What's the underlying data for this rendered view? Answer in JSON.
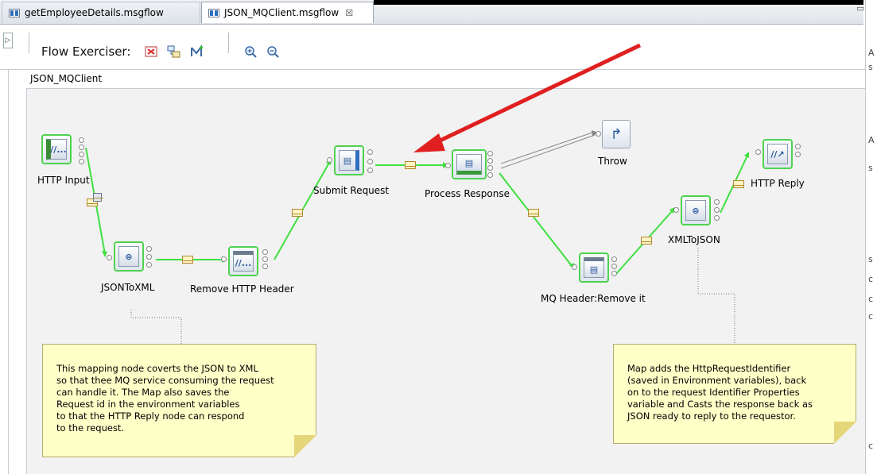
{
  "tabs": [
    {
      "label": "getEmployeeDetails.msgflow"
    },
    {
      "label": "JSON_MQClient.msgflow"
    }
  ],
  "tab_close_glyph": "☒",
  "window_controls": "▭",
  "toolbar": {
    "flow_exerciser_label": "Flow Exerciser:",
    "icons": [
      "stop-recording-icon",
      "view-data-icon",
      "send-message-icon",
      "zoom-in-icon",
      "zoom-out-icon"
    ]
  },
  "breadcrumb": "JSON_MQClient",
  "nodes": {
    "http_input": "HTTP Input",
    "json_to_xml": "JSONToXML",
    "remove_http_header": "Remove HTTP Header",
    "submit_request": "Submit Request",
    "process_response": "Process Response",
    "throw": "Throw",
    "mq_header_remove": "MQ Header:Remove it",
    "xml_to_json": "XMLToJSON",
    "http_reply": "HTTP Reply"
  },
  "notes": {
    "left": "This mapping node coverts the JSON to XML\nso that thee MQ service consuming the request\ncan handle it. The Map also saves the\nRequest id in the environment variables\nto that the HTTP Reply node can respond\nto the request.",
    "right": "Map adds the HttpRequestIdentifier\n(saved in Environment variables), back\non to the request Identifier Properties\nvariable and Casts the response back as\nJSON ready to reply to the requestor."
  },
  "colors": {
    "wire": "#3fe03f",
    "node_border": "#4fd24f",
    "annotation_arrow": "#e02020",
    "note_bg": "#ffffc8",
    "canvas_bg": "#f2f2f2"
  }
}
